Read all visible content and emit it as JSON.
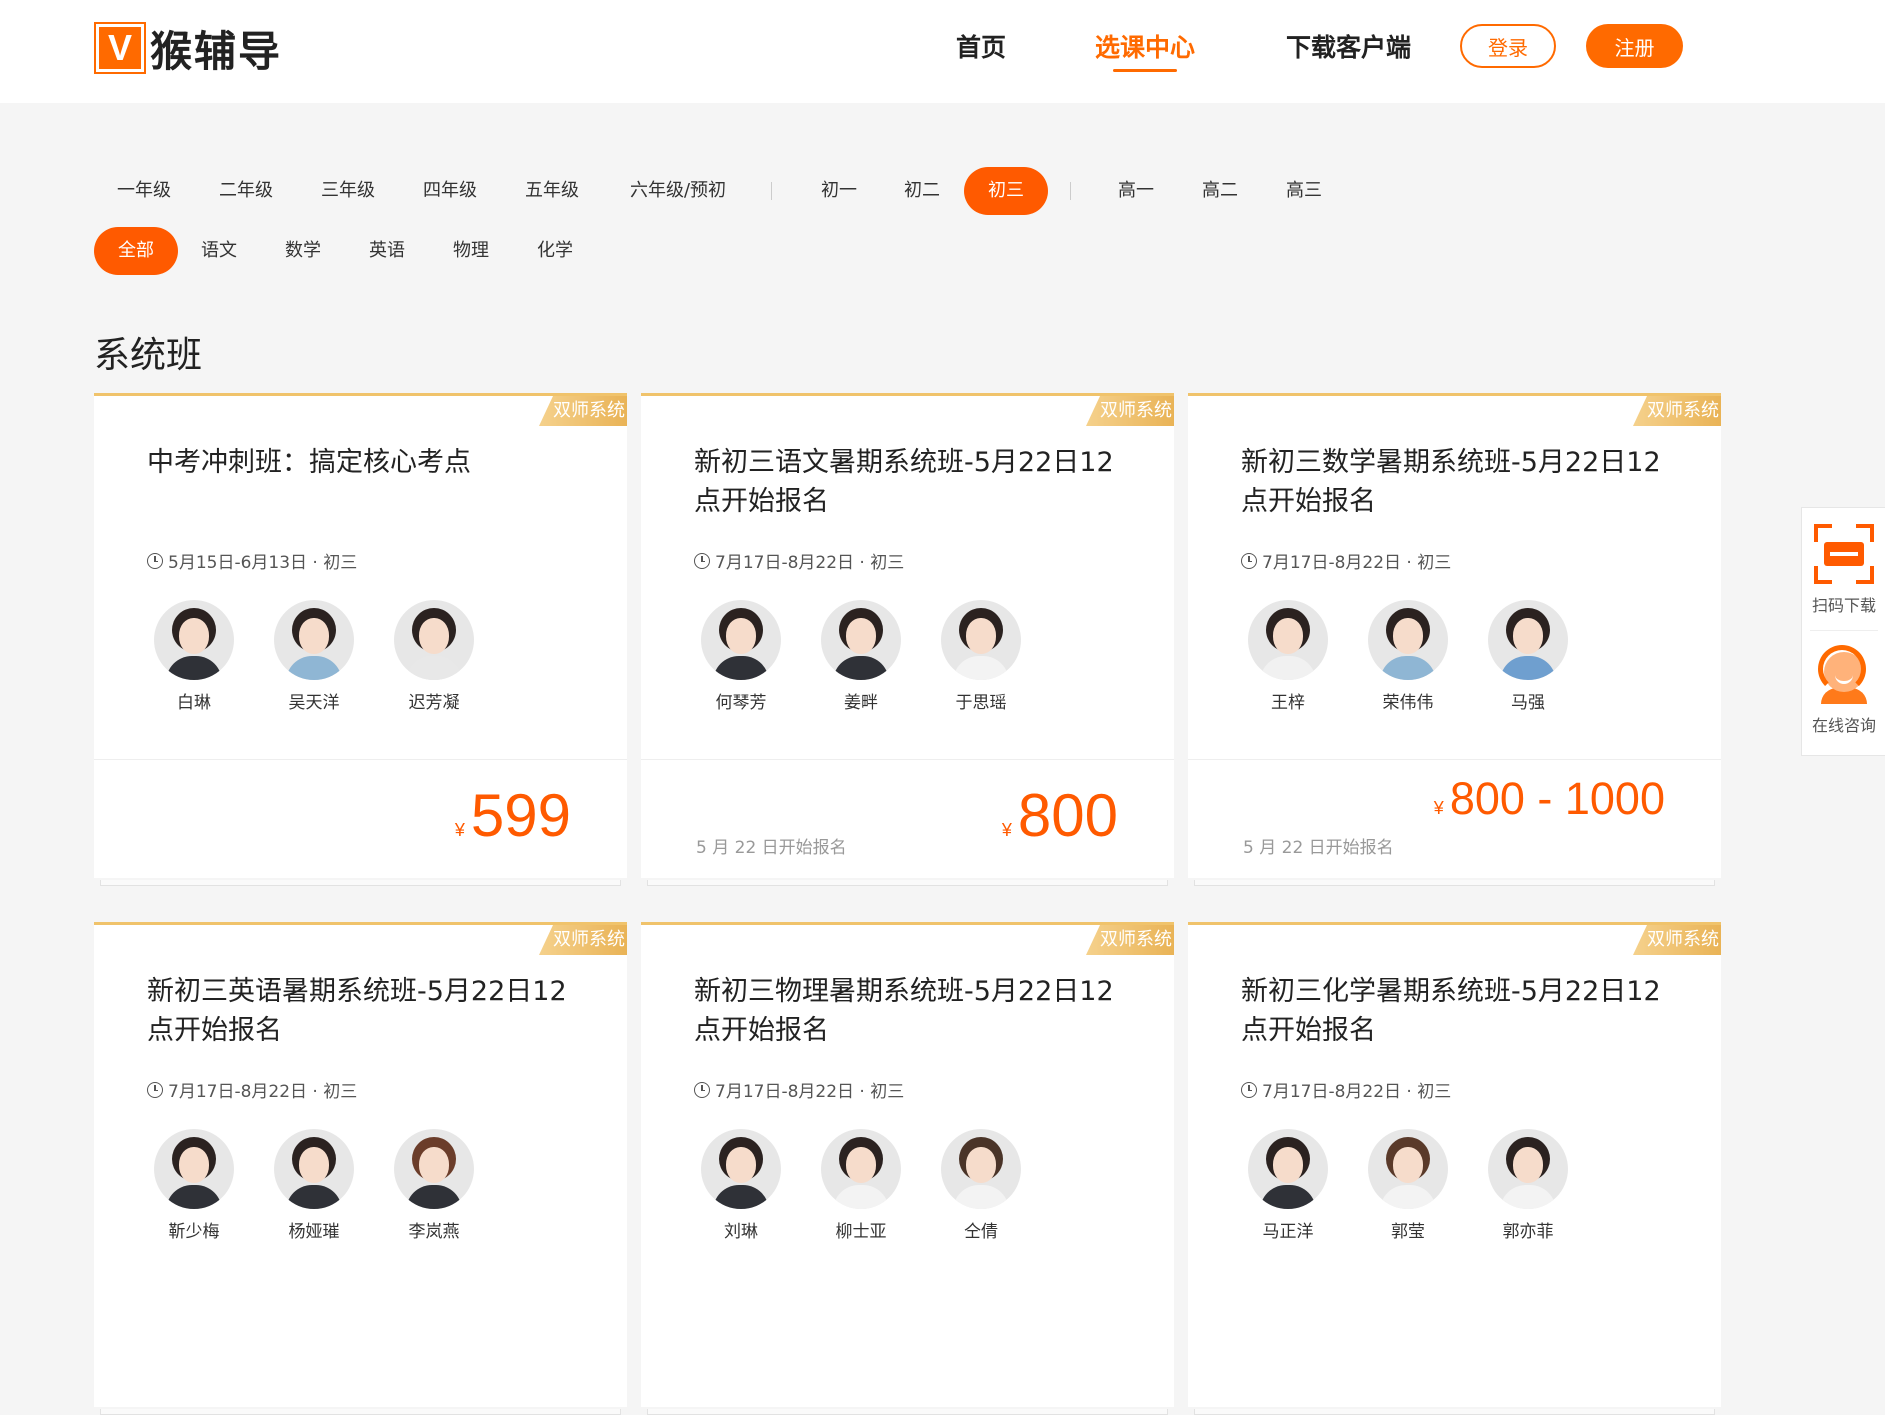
{
  "header": {
    "logo_mark": "V",
    "logo_text": "猴辅导",
    "nav": [
      "首页",
      "选课中心",
      "下载客户端"
    ],
    "login": "登录",
    "register": "注册"
  },
  "grades": [
    "一年级",
    "二年级",
    "三年级",
    "四年级",
    "五年级",
    "六年级/预初",
    "初一",
    "初二",
    "初三",
    "高一",
    "高二",
    "高三"
  ],
  "active_grade": "初三",
  "subjects": [
    "全部",
    "语文",
    "数学",
    "英语",
    "物理",
    "化学"
  ],
  "active_subject": "全部",
  "section_title": "系统班",
  "cards": [
    {
      "tag": "双师系统",
      "title": "中考冲刺班：搞定核心考点",
      "meta": "5月15日-6月13日 · 初三",
      "teachers": [
        "白琳",
        "吴天洋",
        "迟芳凝"
      ],
      "note": "",
      "currency": "¥",
      "price": "599"
    },
    {
      "tag": "双师系统",
      "title": "新初三语文暑期系统班-5月22日12点开始报名",
      "meta": "7月17日-8月22日 · 初三",
      "teachers": [
        "何琴芳",
        "姜畔",
        "于思瑶"
      ],
      "note": "5 月 22 日开始报名",
      "currency": "¥",
      "price": "800"
    },
    {
      "tag": "双师系统",
      "title": "新初三数学暑期系统班-5月22日12点开始报名",
      "meta": "7月17日-8月22日 · 初三",
      "teachers": [
        "王梓",
        "荣伟伟",
        "马强"
      ],
      "note": "5 月 22 日开始报名",
      "currency": "¥",
      "price": "800 - 1000"
    },
    {
      "tag": "双师系统",
      "title": "新初三英语暑期系统班-5月22日12点开始报名",
      "meta": "7月17日-8月22日 · 初三",
      "teachers": [
        "靳少梅",
        "杨娅璀",
        "李岚燕"
      ],
      "note": "",
      "currency": "",
      "price": ""
    },
    {
      "tag": "双师系统",
      "title": "新初三物理暑期系统班-5月22日12点开始报名",
      "meta": "7月17日-8月22日 · 初三",
      "teachers": [
        "刘琳",
        "柳士亚",
        "仝倩"
      ],
      "note": "",
      "currency": "",
      "price": ""
    },
    {
      "tag": "双师系统",
      "title": "新初三化学暑期系统班-5月22日12点开始报名",
      "meta": "7月17日-8月22日 · 初三",
      "teachers": [
        "马正洋",
        "郭莹",
        "郭亦菲"
      ],
      "note": "",
      "currency": "",
      "price": ""
    }
  ],
  "float_bar": {
    "scan": "扫码下载",
    "consult": "在线咨询"
  },
  "colors": {
    "accent": "#ff5a00",
    "tag_gold": "#e9b356"
  }
}
